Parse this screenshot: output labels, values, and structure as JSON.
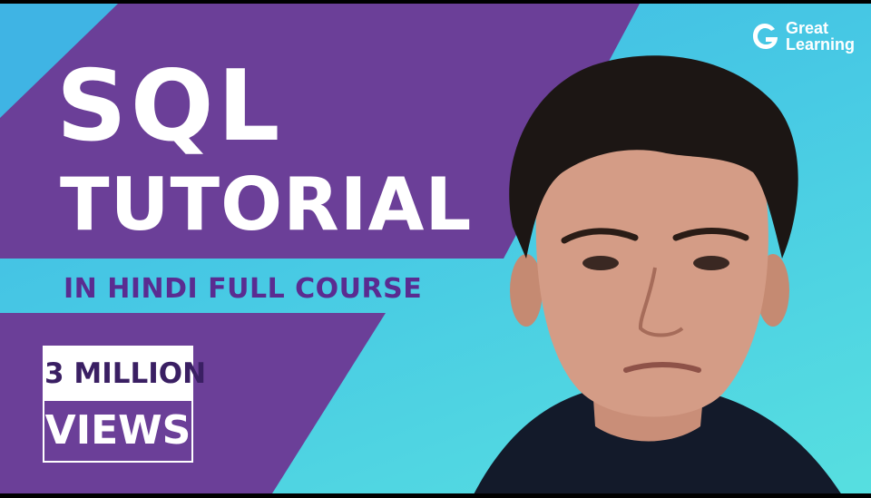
{
  "title": {
    "line1": "SQL",
    "line2": "TUTORIAL"
  },
  "subtitle": "IN HINDI FULL COURSE",
  "views_badge": {
    "count": "3 MILLION",
    "label": "VIEWS"
  },
  "brand": {
    "line1": "Great",
    "line2": "Learning",
    "icon": "great-learning-g-icon"
  },
  "colors": {
    "purple": "#6a3d97",
    "cyan": "#4cc4e6",
    "subtitle": "#5a2c91",
    "white": "#ffffff"
  }
}
